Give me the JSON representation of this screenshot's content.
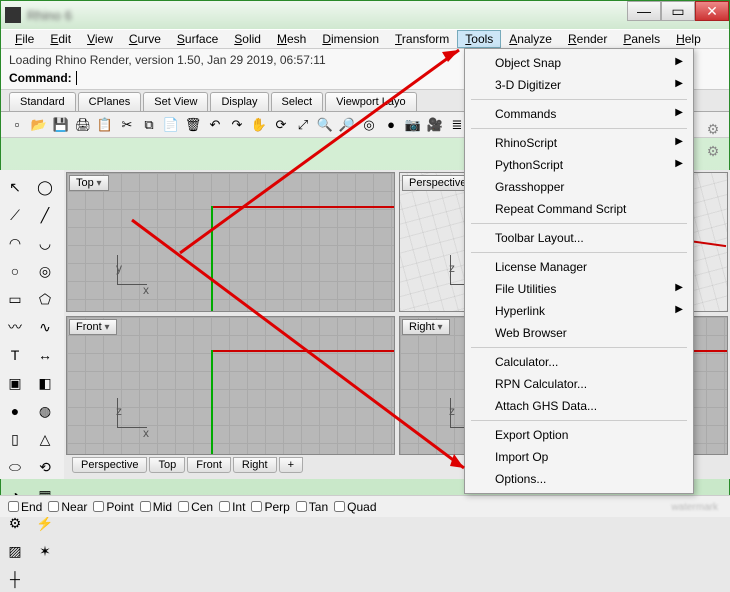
{
  "window": {
    "title": "Rhino 6"
  },
  "menubar": [
    "File",
    "Edit",
    "View",
    "Curve",
    "Surface",
    "Solid",
    "Mesh",
    "Dimension",
    "Transform",
    "Tools",
    "Analyze",
    "Render",
    "Panels",
    "Help"
  ],
  "status": {
    "loading": "Loading Rhino Render, version 1.50, Jan 29 2019, 06:57:11",
    "command_label": "Command:"
  },
  "tabs": [
    "Standard",
    "CPlanes",
    "Set View",
    "Display",
    "Select",
    "Viewport Layo"
  ],
  "toolbar_icons": [
    "new",
    "open",
    "save",
    "print",
    "clip",
    "scissors",
    "copy",
    "paste",
    "can",
    "undo",
    "redo",
    "hand",
    "rotate",
    "zoom-ext",
    "zoom-win",
    "zoom",
    "target",
    "render",
    "cam1",
    "cam2",
    "layer"
  ],
  "left_tools": [
    "pointer",
    "lasso",
    "polyline",
    "line",
    "arc",
    "arc2",
    "circle",
    "circle2",
    "rect",
    "polygon",
    "curve",
    "curve2",
    "text",
    "dim",
    "solid1",
    "solid2",
    "sphere",
    "torus",
    "cyl",
    "cone",
    "pipe",
    "revolve",
    "boolean",
    "mesh",
    "gear",
    "bolt",
    "hatch",
    "explode",
    "axis"
  ],
  "viewports": {
    "tl": "Top",
    "tr": "Perspective",
    "bl": "Front",
    "br": "Right"
  },
  "viewtabs": [
    "Perspective",
    "Top",
    "Front",
    "Right"
  ],
  "osnap": [
    "End",
    "Near",
    "Point",
    "Mid",
    "Cen",
    "Int",
    "Perp",
    "Tan",
    "Quad"
  ],
  "tools_menu": {
    "groups": [
      [
        {
          "label": "Object Snap",
          "sub": true
        },
        {
          "label": "3-D Digitizer",
          "sub": true
        }
      ],
      [
        {
          "label": "Commands",
          "sub": true
        }
      ],
      [
        {
          "label": "RhinoScript",
          "sub": true
        },
        {
          "label": "PythonScript",
          "sub": true
        },
        {
          "label": "Grasshopper"
        },
        {
          "label": "Repeat Command Script"
        }
      ],
      [
        {
          "label": "Toolbar Layout..."
        }
      ],
      [
        {
          "label": "License Manager"
        },
        {
          "label": "File Utilities",
          "sub": true
        },
        {
          "label": "Hyperlink",
          "sub": true
        },
        {
          "label": "Web Browser"
        }
      ],
      [
        {
          "label": "Calculator..."
        },
        {
          "label": "RPN Calculator..."
        },
        {
          "label": "Attach GHS Data..."
        }
      ],
      [
        {
          "label": "Export Option"
        },
        {
          "label": "Import Op"
        },
        {
          "label": "Options..."
        }
      ]
    ]
  }
}
